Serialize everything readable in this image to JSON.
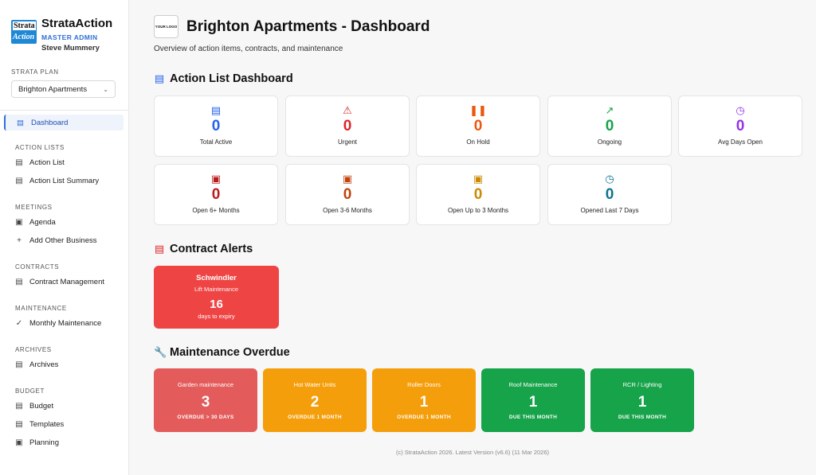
{
  "sidebar": {
    "brand_logo_line1": "Strata",
    "brand_logo_line2": "Action",
    "brand_name": "StrataAction",
    "role": "MASTER ADMIN",
    "user": "Steve Mummery",
    "plan_label": "STRATA PLAN",
    "plan_value": "Brighton Apartments",
    "active_item": "Dashboard",
    "sections": {
      "action_lists": {
        "title": "ACTION LISTS",
        "items": [
          "Action List",
          "Action List Summary"
        ]
      },
      "meetings": {
        "title": "MEETINGS",
        "items": [
          "Agenda",
          "Add Other Business"
        ]
      },
      "contracts": {
        "title": "CONTRACTS",
        "items": [
          "Contract Management"
        ]
      },
      "maintenance": {
        "title": "MAINTENANCE",
        "items": [
          "Monthly Maintenance"
        ]
      },
      "archives": {
        "title": "ARCHIVES",
        "items": [
          "Archives"
        ]
      },
      "budget": {
        "title": "BUDGET",
        "items": [
          "Budget",
          "Templates",
          "Planning"
        ]
      }
    }
  },
  "header": {
    "logo_text": "YOUR LOGO",
    "title": "Brighton Apartments - Dashboard",
    "subtitle": "Overview of action items, contracts, and maintenance"
  },
  "action_dashboard": {
    "title": "Action List Dashboard",
    "cards": [
      {
        "label": "Total Active",
        "value": "0",
        "color": "#2563eb",
        "icon": "clipboard-icon"
      },
      {
        "label": "Urgent",
        "value": "0",
        "color": "#dc2626",
        "icon": "alert-triangle-icon"
      },
      {
        "label": "On Hold",
        "value": "0",
        "color": "#ea580c",
        "icon": "pause-icon"
      },
      {
        "label": "Ongoing",
        "value": "0",
        "color": "#16a34a",
        "icon": "trending-up-icon"
      },
      {
        "label": "Avg Days Open",
        "value": "0",
        "color": "#9333ea",
        "icon": "clock-icon"
      },
      {
        "label": "Open 6+ Months",
        "value": "0",
        "color": "#b91c1c",
        "icon": "calendar-icon"
      },
      {
        "label": "Open 3-6 Months",
        "value": "0",
        "color": "#c2410c",
        "icon": "calendar-icon"
      },
      {
        "label": "Open Up to 3 Months",
        "value": "0",
        "color": "#ca8a04",
        "icon": "calendar-icon"
      },
      {
        "label": "Opened Last 7 Days",
        "value": "0",
        "color": "#0e7490",
        "icon": "clock-icon"
      }
    ]
  },
  "contract_alerts": {
    "title": "Contract Alerts",
    "items": [
      {
        "name": "Schwindler",
        "type": "Lift Maintenance",
        "days": "16",
        "unit": "days to expiry",
        "color": "#ef4444"
      }
    ]
  },
  "maintenance_overdue": {
    "title": "Maintenance Overdue",
    "items": [
      {
        "name": "Garden maintenance",
        "count": "3",
        "status": "OVERDUE > 30 DAYS",
        "color": "#e35b5b"
      },
      {
        "name": "Hot Water Units",
        "count": "2",
        "status": "OVERDUE 1 MONTH",
        "color": "#f59e0b"
      },
      {
        "name": "Roller Doors",
        "count": "1",
        "status": "OVERDUE 1 MONTH",
        "color": "#f59e0b"
      },
      {
        "name": "Roof Maintenance",
        "count": "1",
        "status": "DUE THIS MONTH",
        "color": "#16a34a"
      },
      {
        "name": "RCR / Lighting",
        "count": "1",
        "status": "DUE THIS MONTH",
        "color": "#16a34a"
      }
    ]
  },
  "footer": "(c) StrataAction 2026. Latest Version (v6.6) (11 Mar 2026)"
}
